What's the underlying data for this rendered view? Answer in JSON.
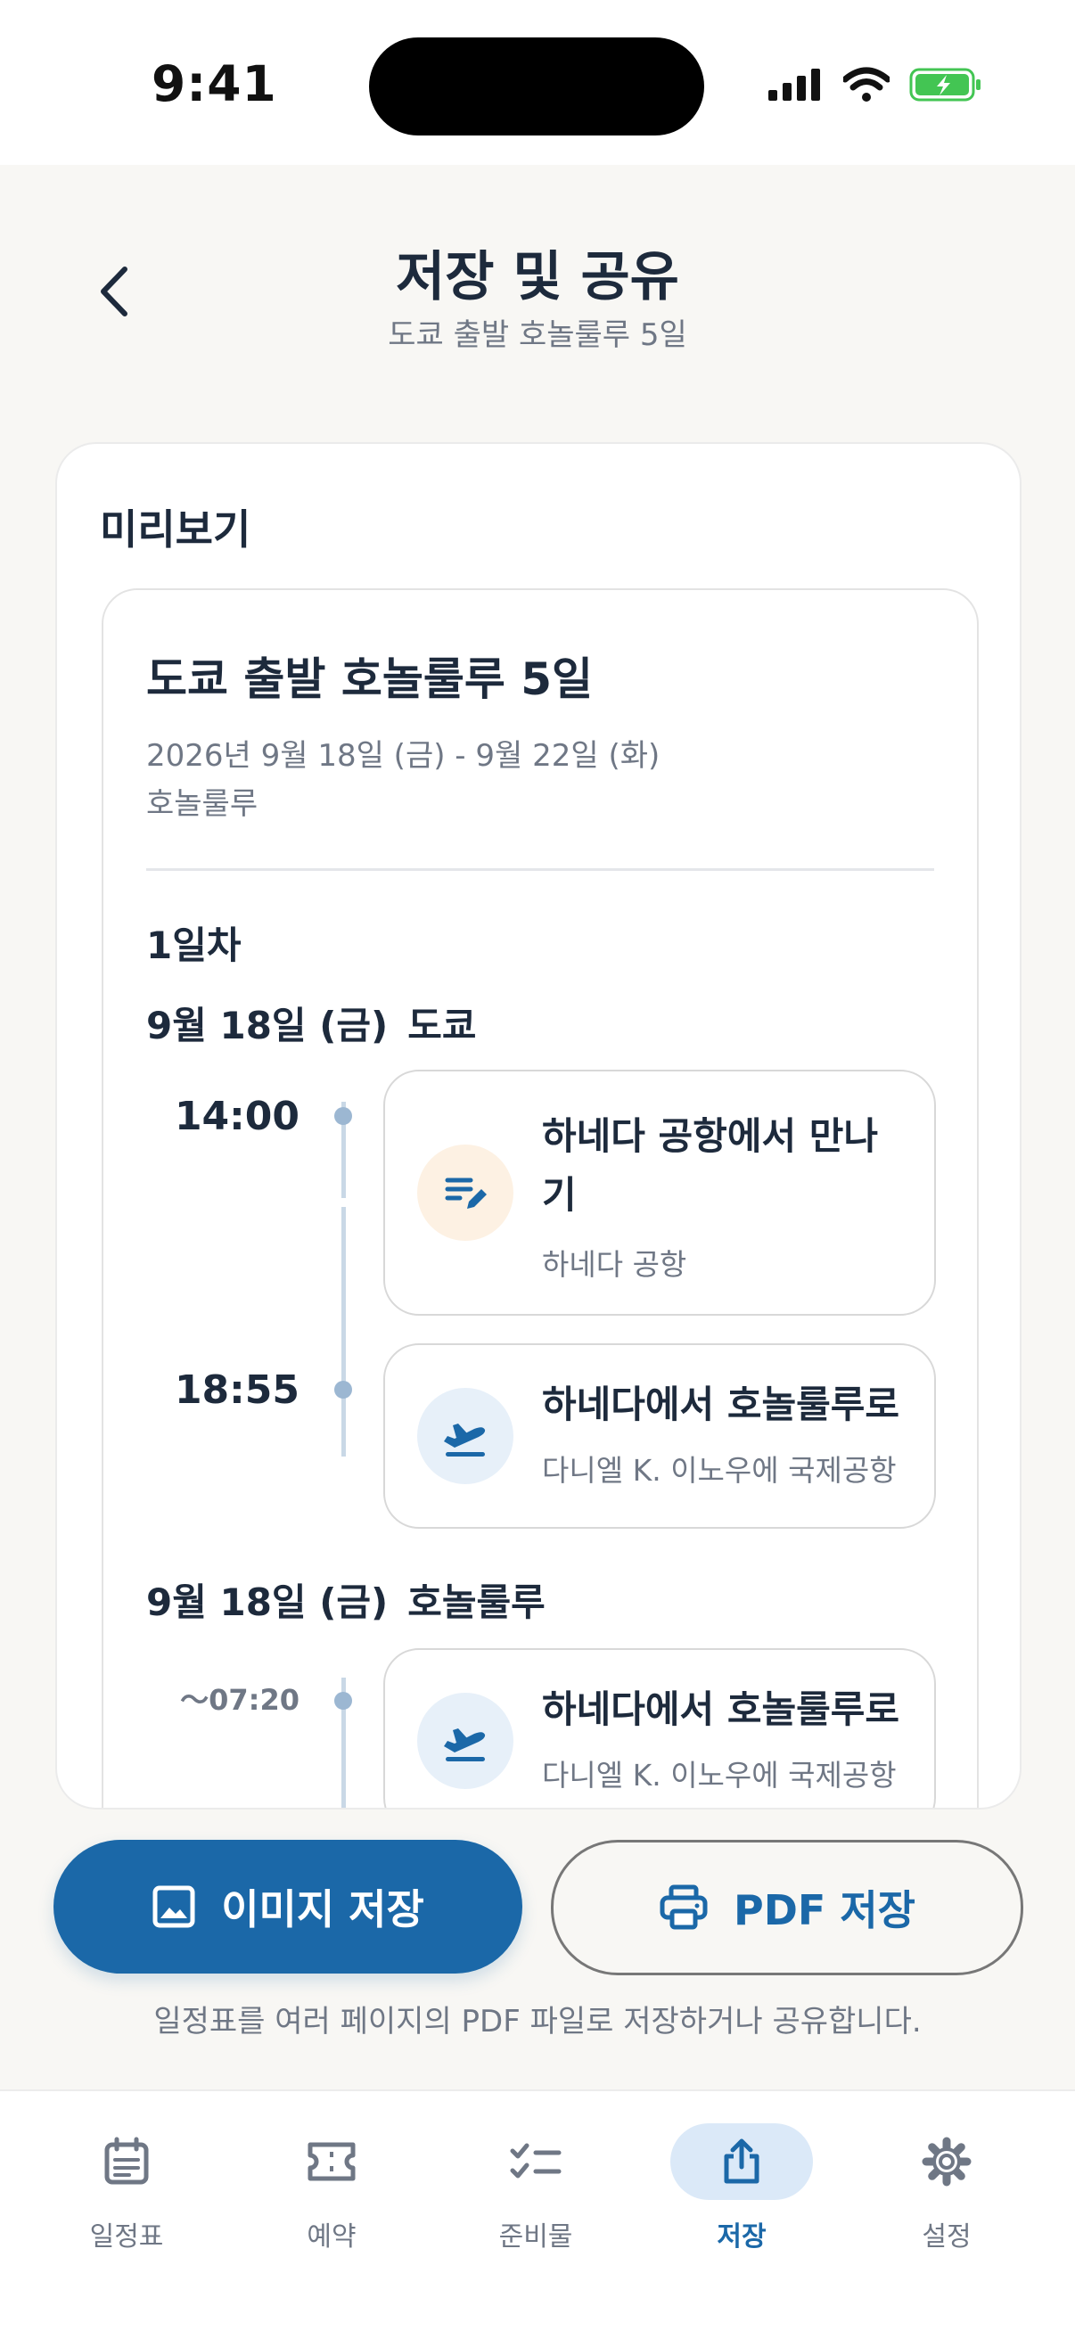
{
  "status_bar": {
    "time": "9:41"
  },
  "header": {
    "title": "저장 및 공유",
    "subtitle": "도쿄 출발 호놀룰루 5일"
  },
  "preview": {
    "label": "미리보기",
    "doc_title": "도쿄 출발 호놀룰루 5일",
    "dates": "2026년 9월 18일 (금) - 9월 22일 (화)",
    "destination": "호놀룰루",
    "day_label": "1일차",
    "sections": [
      {
        "date": "9월 18일 (금)",
        "city": "도쿄",
        "events": [
          {
            "time": "14:00",
            "title": "하네다 공항에서 만나기",
            "subtitle": "하네다 공항",
            "icon": "note-edit-icon",
            "accent": "#f5a24a"
          },
          {
            "time": "18:55",
            "title": "하네다에서 호놀룰루로",
            "subtitle": "다니엘 K. 이노우에 국제공항",
            "icon": "plane-departure-icon",
            "accent": "#1b68a8"
          }
        ]
      },
      {
        "date": "9월 18일 (금)",
        "city": "호놀룰루",
        "events": [
          {
            "time": "〜07:20",
            "title": "하네다에서 호놀룰루로",
            "subtitle": "다니엘 K. 이노우에 국제공항",
            "icon": "plane-departure-icon",
            "accent": "#1b68a8"
          }
        ]
      }
    ]
  },
  "actions": {
    "save_image": "이미지 저장",
    "save_pdf": "PDF 저장",
    "helper": "일정표를 여러 페이지의 PDF 파일로 저장하거나 공유합니다."
  },
  "tabs": [
    {
      "label": "일정표",
      "icon": "calendar-icon",
      "active": false
    },
    {
      "label": "예약",
      "icon": "ticket-icon",
      "active": false
    },
    {
      "label": "준비물",
      "icon": "checklist-icon",
      "active": false
    },
    {
      "label": "저장",
      "icon": "share-icon",
      "active": true
    },
    {
      "label": "설정",
      "icon": "gear-icon",
      "active": false
    }
  ],
  "colors": {
    "primary": "#1b68a8",
    "text": "#1d2a3c",
    "muted": "#6f7785",
    "background": "#f8f7f4"
  }
}
